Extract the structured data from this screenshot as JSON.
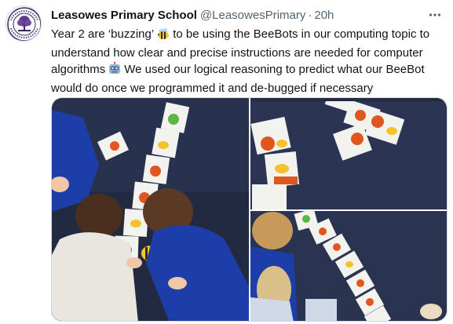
{
  "account": {
    "name": "Leasowes Primary School",
    "handle": "@LeasowesPrimary",
    "separator": "·",
    "time": "20h"
  },
  "tweet": {
    "text_part1": "Year 2 are ‘buzzing’",
    "text_part2": "to be using the BeeBots in our computing topic to understand how clear and precise instructions are needed for computer algorithms",
    "text_part3": "We used our logical reasoning to predict what our BeeBot would do once we programmed it and de-bugged if necessary"
  },
  "icons": {
    "more": "more-horizontal-icon",
    "bee_emoji": "bee-emoji-icon",
    "robot_emoji": "robot-emoji-icon"
  },
  "media": {
    "photo_count": 3
  },
  "colors": {
    "primary_text": "#0f1419",
    "secondary_text": "#536471",
    "border": "#cfd9de",
    "carpet": "#2a3350",
    "card": "#f2f2ee",
    "arrow_orange": "#e0561f",
    "uniform_blue": "#1d3ea8"
  }
}
